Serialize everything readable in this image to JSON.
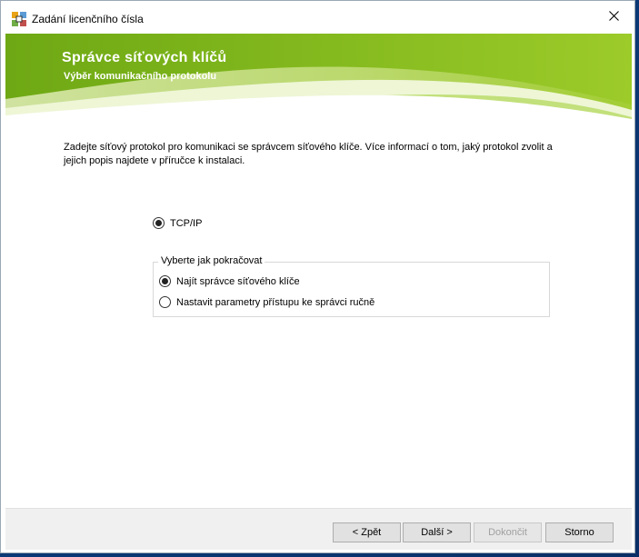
{
  "window": {
    "title": "Zadání licenčního čísla",
    "icon": "license-key-app-icon",
    "close_glyph": "✕"
  },
  "banner": {
    "title": "Správce síťových klíčů",
    "subtitle": "Výběr komunikačního protokolu",
    "colors": {
      "base": "#7fb51b",
      "light": "#cfe58a",
      "accent": "#f4f9e4"
    }
  },
  "content": {
    "description": "Zadejte síťový protokol pro komunikaci se správcem síťového klíče. Více informací o tom, jaký protokol zvolit a jejich popis najdete v příručce k instalaci.",
    "protocol": {
      "label": "TCP/IP",
      "checked": true
    },
    "group": {
      "legend": "Vyberte jak pokračovat",
      "options": [
        {
          "label": "Najít správce síťového klíče",
          "checked": true
        },
        {
          "label": "Nastavit parametry přístupu ke správci ručně",
          "checked": false
        }
      ]
    }
  },
  "footer": {
    "back_label": "< Zpět",
    "next_label": "Další >",
    "finish_label": "Dokončit",
    "cancel_label": "Storno",
    "finish_enabled": false
  }
}
